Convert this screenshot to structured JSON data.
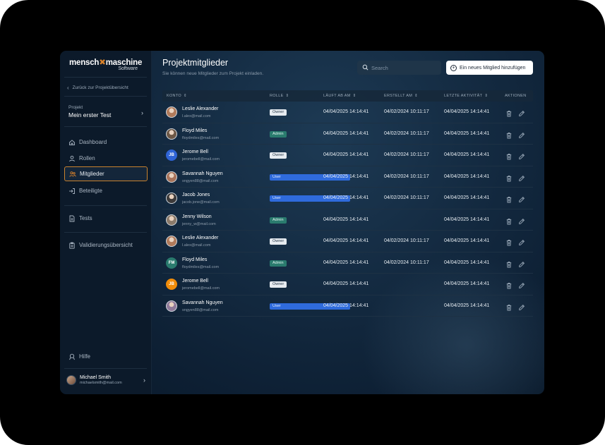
{
  "brand": {
    "name_left": "mensch",
    "name_x": "✖",
    "name_right": "maschine",
    "sub": "Software"
  },
  "sidebar": {
    "back_label": "Zurück zur Projektübersicht",
    "project_label": "Projekt",
    "project_name": "Mein erster Test",
    "items": [
      {
        "label": "Dashboard",
        "icon": "home-icon"
      },
      {
        "label": "Rollen",
        "icon": "person-icon"
      },
      {
        "label": "Mitglieder",
        "icon": "group-icon",
        "active": true
      },
      {
        "label": "Beteiligte",
        "icon": "enter-icon"
      },
      {
        "label": "Tests",
        "icon": "document-icon"
      },
      {
        "label": "Validierungsübersicht",
        "icon": "clipboard-icon"
      }
    ],
    "help_label": "Hilfe",
    "user_name": "Michael Smith",
    "user_email": "michaelsmith@mail.com"
  },
  "header": {
    "title": "Projektmitglieder",
    "subtitle": "Sie können neue Mitglieder zum Projekt einladen.",
    "search_placeholder": "Search",
    "add_button": "Ein neues Mitglied hinzufügen"
  },
  "table": {
    "columns": {
      "konto": "KONTO",
      "rolle": "ROLLE",
      "laeuft_ab": "LÄUFT AB AM",
      "erstellt": "ERSTELLT AM",
      "aktivitaet": "LETZTE AKTIVITÄT",
      "aktionen": "AKTIONEN"
    },
    "sort_glyph": "⇕",
    "rows": [
      {
        "name": "Leslie Alexander",
        "email": "l.alex@mail.com",
        "role": "Owner",
        "expires": "04/04/2025 14:14:41",
        "created": "04/02/2024 10:11:17",
        "activity": "04/04/2025 14:14:41",
        "avatar": "photo",
        "avatar_color": "#b07a5a"
      },
      {
        "name": "Floyd Miles",
        "email": "floydmiles@mail.com",
        "role": "Admin",
        "expires": "04/04/2025 14:14:41",
        "created": "04/02/2024 10:11:17",
        "activity": "04/04/2025 14:14:41",
        "avatar": "photo",
        "avatar_color": "#6d5846"
      },
      {
        "name": "Jerome Bell",
        "email": "jeromebell@mail.com",
        "role": "Owner",
        "expires": "04/04/2025 14:14:41",
        "created": "04/02/2024 10:11:17",
        "activity": "04/04/2025 14:14:41",
        "avatar": "JB",
        "avatar_color": "#2f64d6"
      },
      {
        "name": "Savannah Nguyen",
        "email": "sngyen88@mail.com",
        "role": "User",
        "expires": "04/04/2025 14:14:41",
        "created": "04/02/2024 10:11:17",
        "activity": "04/04/2025 14:14:41",
        "avatar": "photo",
        "avatar_color": "#a8735a"
      },
      {
        "name": "Jacob Jones",
        "email": "jacob.jone@mail.com",
        "role": "User",
        "expires": "04/04/2025 14:14:41",
        "created": "04/02/2024 10:11:17",
        "activity": "04/04/2025 14:14:41",
        "avatar": "photo",
        "avatar_color": "#3c3a3a"
      },
      {
        "name": "Jenny Wilson",
        "email": "jenny_w@mail.com",
        "role": "Admin",
        "expires": "04/04/2025 14:14:41",
        "created": "",
        "activity": "04/04/2025 14:14:41",
        "avatar": "photo",
        "avatar_color": "#8b7a6a"
      },
      {
        "name": "Leslie Alexander",
        "email": "l.alex@mail.com",
        "role": "Owner",
        "expires": "04/04/2025 14:14:41",
        "created": "04/02/2024 10:11:17",
        "activity": "04/04/2025 14:14:41",
        "avatar": "photo",
        "avatar_color": "#b07a5a"
      },
      {
        "name": "Floyd Miles",
        "email": "floydmiles@mail.com",
        "role": "Admin",
        "expires": "04/04/2025 14:14:41",
        "created": "04/02/2024 10:11:17",
        "activity": "04/04/2025 14:14:41",
        "avatar": "FM",
        "avatar_color": "#2a7b6e"
      },
      {
        "name": "Jerome Bell",
        "email": "jeromebell@mail.com",
        "role": "Owner",
        "expires": "04/04/2025 14:14:41",
        "created": "",
        "activity": "04/04/2025 14:14:41",
        "avatar": "JB",
        "avatar_color": "#f08c0a"
      },
      {
        "name": "Savannah Nguyen",
        "email": "sngyen88@mail.com",
        "role": "User",
        "expires": "04/04/2025 14:14:41",
        "created": "",
        "activity": "04/04/2025 14:14:41",
        "avatar": "photo",
        "avatar_color": "#8f7a9a"
      }
    ]
  }
}
